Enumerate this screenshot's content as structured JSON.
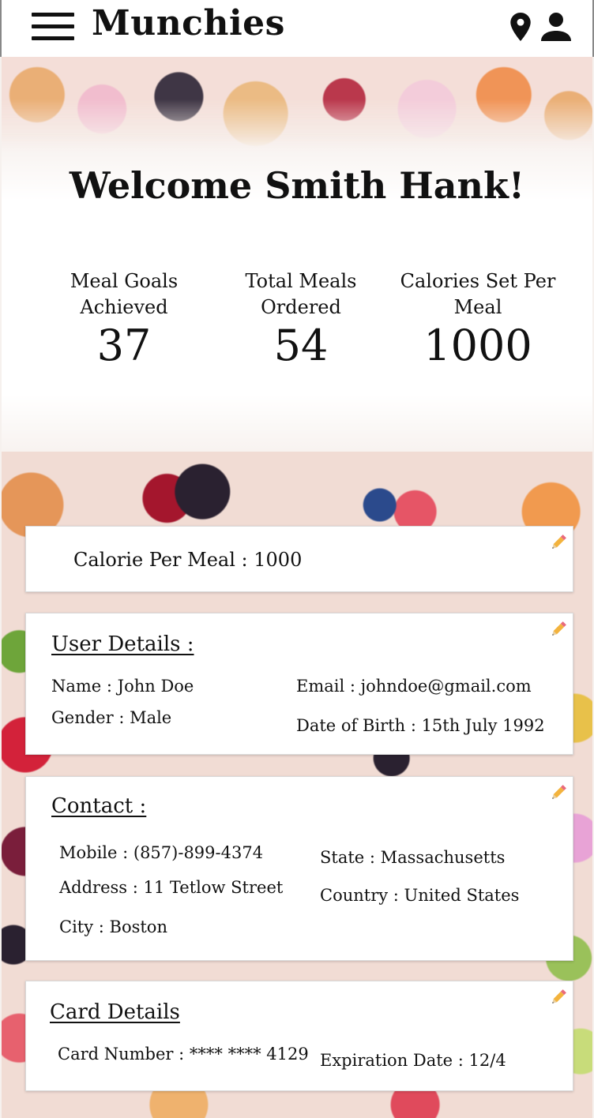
{
  "header": {
    "title": "Munchies",
    "menu_icon": "hamburger-menu-icon",
    "location_icon": "location-pin-icon",
    "profile_icon": "user-icon"
  },
  "hero": {
    "welcome": "Welcome Smith Hank!",
    "stats": [
      {
        "label": "Meal Goals Achieved",
        "value": "37"
      },
      {
        "label": "Total Meals Ordered",
        "value": "54"
      },
      {
        "label": "Calories Set Per Meal",
        "value": "1000"
      }
    ]
  },
  "calorie_card": {
    "text": "Calorie Per Meal : 1000",
    "edit_icon": "pencil-icon"
  },
  "user_details": {
    "heading": "User Details :",
    "name": "Name : John Doe",
    "gender": "Gender : Male",
    "email": "Email : johndoe@gmail.com",
    "dob": "Date of Birth : 15th July 1992"
  },
  "contact": {
    "heading": "Contact :",
    "mobile": "Mobile : (857)-899-4374",
    "address": "Address : 11 Tetlow Street",
    "city": "City : Boston",
    "state": "State : Massachusetts",
    "country": "Country : United States"
  },
  "card_details": {
    "heading": "Card Details",
    "number": "Card Number : **** **** 4129",
    "expiration": "Expiration Date : 12/4"
  }
}
